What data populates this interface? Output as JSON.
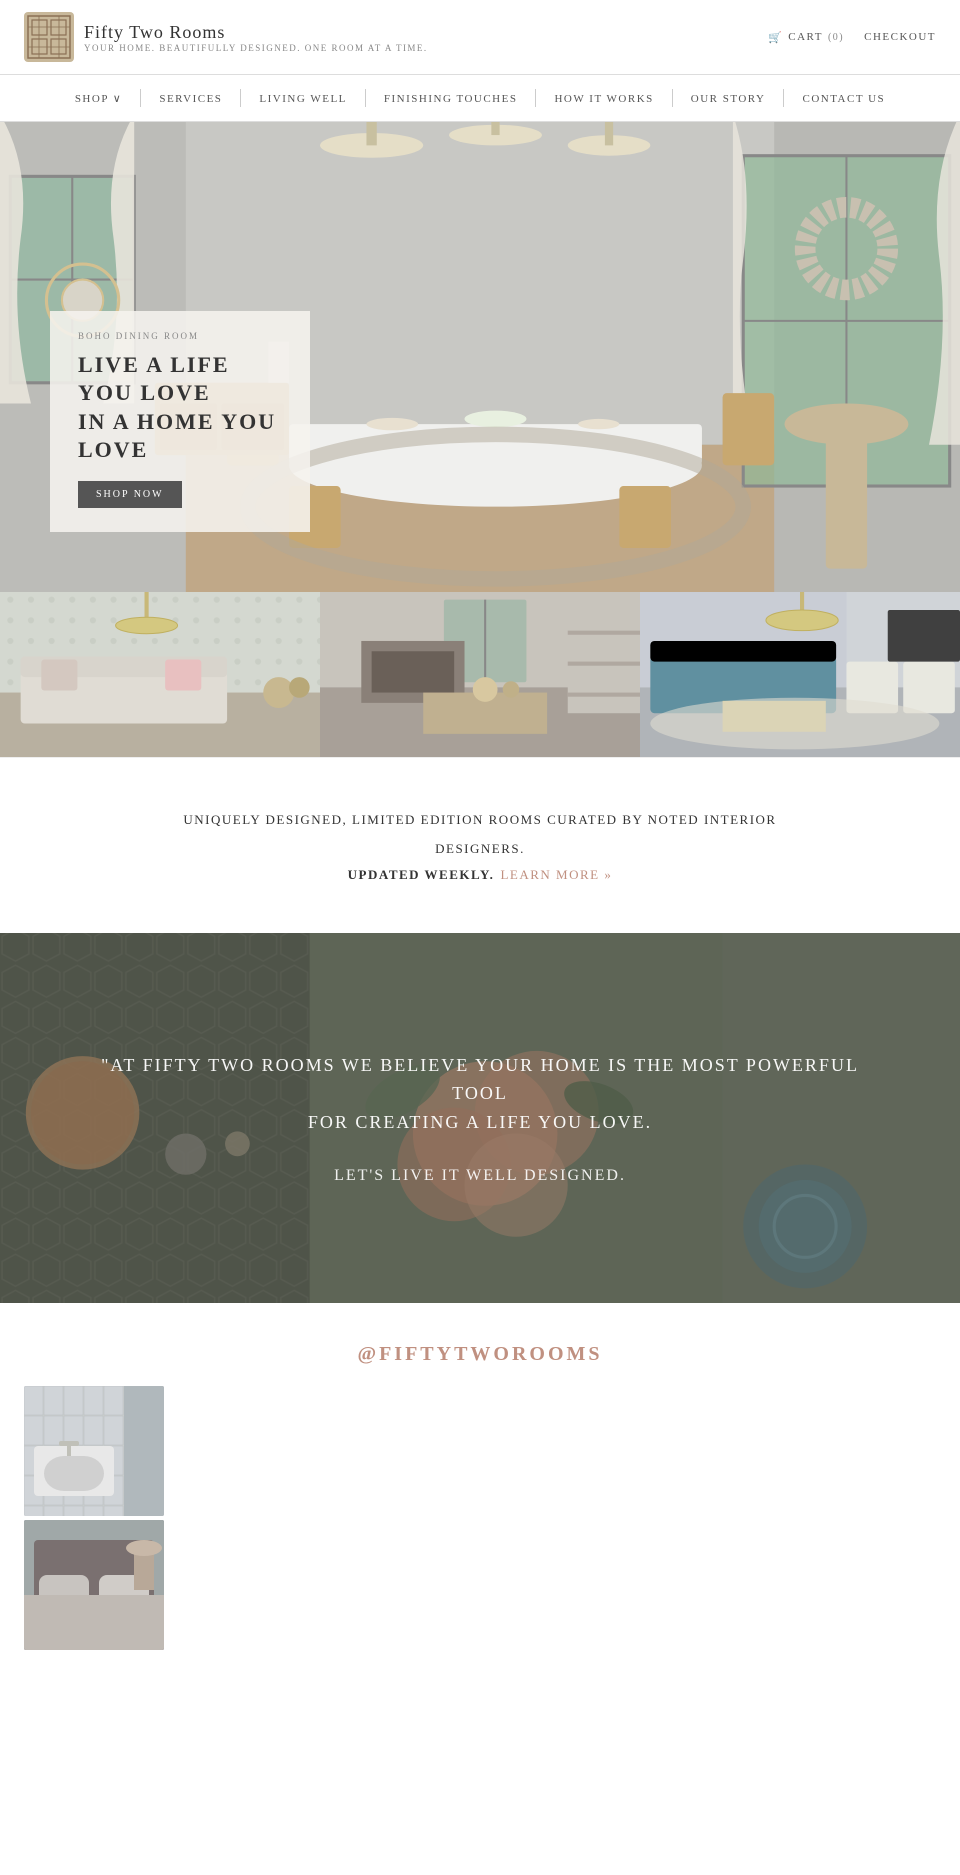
{
  "site": {
    "name": "Fifty Two Rooms",
    "tagline": "YOUR HOME. BEAUTIFULLY DESIGNED. ONE ROOM AT A TIME."
  },
  "header": {
    "cart_label": "CART",
    "cart_count": "(0)",
    "checkout_label": "CHECKOUT"
  },
  "nav": {
    "items": [
      {
        "label": "SHOP ∨",
        "href": "#"
      },
      {
        "label": "SERVICES",
        "href": "#"
      },
      {
        "label": "LIVING WELL",
        "href": "#"
      },
      {
        "label": "FINISHING TOUCHES",
        "href": "#"
      },
      {
        "label": "HOW IT WORKS",
        "href": "#"
      },
      {
        "label": "OUR STORY",
        "href": "#"
      },
      {
        "label": "CONTACT US",
        "href": "#"
      }
    ]
  },
  "hero": {
    "room_label": "BOHO DINING ROOM",
    "title_line1": "LIVE A LIFE YOU LOVE",
    "title_line2": "IN A HOME YOU LOVE",
    "button_label": "SHOP NOW"
  },
  "info": {
    "line1": "UNIQUELY DESIGNED, LIMITED EDITION ROOMS CURATED BY NOTED INTERIOR",
    "line2": "DESIGNERS.",
    "updated_prefix": "UPDATED WEEKLY.",
    "learn_more": "LEARN MORE »"
  },
  "quote": {
    "main": "\"AT FIFTY TWO ROOMS WE BELIEVE YOUR HOME IS THE MOST POWERFUL TOOL\nFOR CREATING A LIFE YOU LOVE.",
    "sub": "LET'S LIVE IT WELL DESIGNED."
  },
  "instagram": {
    "handle": "@FIFTYTWOROOMS"
  }
}
